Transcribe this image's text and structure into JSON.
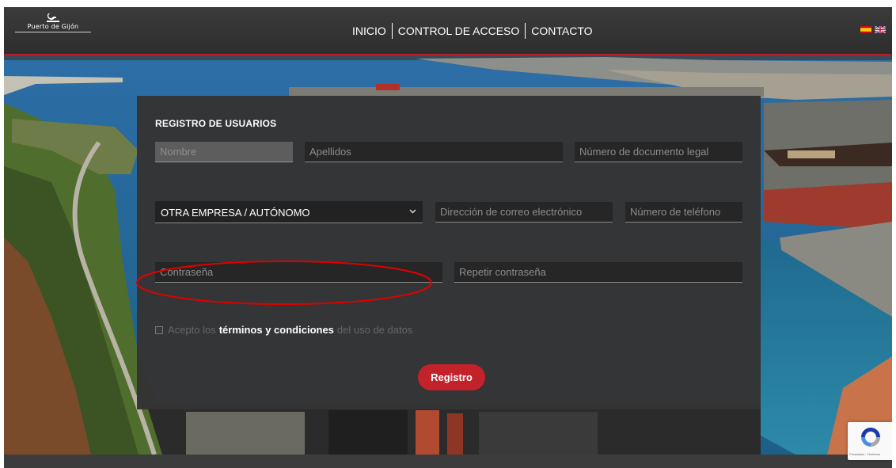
{
  "header": {
    "logo_text": "Puerto de Gijón",
    "nav": [
      "INICIO",
      "CONTROL DE ACCESO",
      "CONTACTO"
    ]
  },
  "form": {
    "title": "REGISTRO DE USUARIOS",
    "nombre_placeholder": "Nombre",
    "apellidos_placeholder": "Apellidos",
    "documento_placeholder": "Número de documento legal",
    "empresa_selected": "OTRA EMPRESA / AUTÓNOMO",
    "email_placeholder": "Dirección de correo electrónico",
    "telefono_placeholder": "Número de teléfono",
    "password_placeholder": "Contraseña",
    "password_repeat_placeholder": "Repetir contraseña",
    "terms_prefix": "Acepto los",
    "terms_link": "términos y condiciones",
    "terms_suffix": "del uso de datos",
    "submit_label": "Registro"
  },
  "recaptcha": {
    "footer_text": "Privacidad - Términos"
  },
  "colors": {
    "accent": "#c3222a",
    "header_bg": "#333333",
    "panel_bg": "#343434",
    "annotation": "#e00000"
  }
}
